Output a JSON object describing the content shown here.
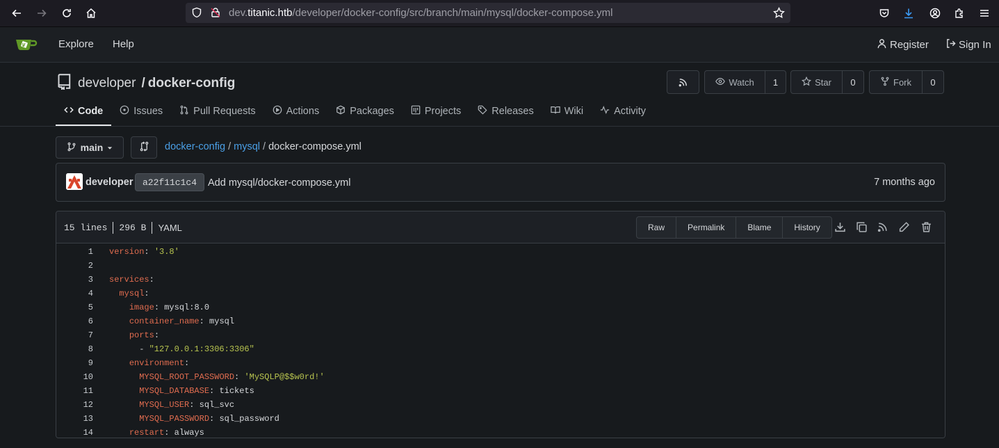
{
  "browser": {
    "url_prefix": "dev.",
    "url_host": "titanic.htb",
    "url_path": "/developer/docker-config/src/branch/main/mysql/docker-compose.yml"
  },
  "header": {
    "explore": "Explore",
    "help": "Help",
    "register": "Register",
    "sign_in": "Sign In"
  },
  "repo": {
    "owner": "developer",
    "separator": "/",
    "name": "docker-config",
    "watch_label": "Watch",
    "watch_count": "1",
    "star_label": "Star",
    "star_count": "0",
    "fork_label": "Fork",
    "fork_count": "0"
  },
  "tabs": [
    {
      "label": "Code",
      "icon": "code-icon"
    },
    {
      "label": "Issues",
      "icon": "issue-icon"
    },
    {
      "label": "Pull Requests",
      "icon": "pull-request-icon"
    },
    {
      "label": "Actions",
      "icon": "play-icon"
    },
    {
      "label": "Packages",
      "icon": "package-icon"
    },
    {
      "label": "Projects",
      "icon": "project-icon"
    },
    {
      "label": "Releases",
      "icon": "tag-icon"
    },
    {
      "label": "Wiki",
      "icon": "book-icon"
    },
    {
      "label": "Activity",
      "icon": "pulse-icon"
    }
  ],
  "branch": {
    "name": "main"
  },
  "breadcrumb": {
    "root": "docker-config",
    "sep1": " / ",
    "dir": "mysql",
    "sep2": " / ",
    "file": "docker-compose.yml"
  },
  "commit": {
    "author": "developer",
    "sha": "a22f11c1c4",
    "message": "Add mysql/docker-compose.yml",
    "time": "7 months ago"
  },
  "file": {
    "lines": "15 lines",
    "size": "296 B",
    "type": "YAML",
    "raw": "Raw",
    "permalink": "Permalink",
    "blame": "Blame",
    "history": "History"
  },
  "code_lines": [
    {
      "n": "1",
      "indent": "",
      "key": "version",
      "colon": ": ",
      "val": "'3.8'",
      "val_type": "s"
    },
    {
      "n": "2",
      "indent": "",
      "key": "",
      "colon": "",
      "val": "",
      "val_type": "p"
    },
    {
      "n": "3",
      "indent": "",
      "key": "services",
      "colon": ":",
      "val": "",
      "val_type": "p"
    },
    {
      "n": "4",
      "indent": "  ",
      "key": "mysql",
      "colon": ":",
      "val": "",
      "val_type": "p"
    },
    {
      "n": "5",
      "indent": "    ",
      "key": "image",
      "colon": ": ",
      "val": "mysql:8.0",
      "val_type": "p"
    },
    {
      "n": "6",
      "indent": "    ",
      "key": "container_name",
      "colon": ": ",
      "val": "mysql",
      "val_type": "p"
    },
    {
      "n": "7",
      "indent": "    ",
      "key": "ports",
      "colon": ":",
      "val": "",
      "val_type": "p"
    },
    {
      "n": "8",
      "indent": "      - ",
      "key": "",
      "colon": "",
      "val": "\"127.0.0.1:3306:3306\"",
      "val_type": "s"
    },
    {
      "n": "9",
      "indent": "    ",
      "key": "environment",
      "colon": ":",
      "val": "",
      "val_type": "p"
    },
    {
      "n": "10",
      "indent": "      ",
      "key": "MYSQL_ROOT_PASSWORD",
      "colon": ": ",
      "val": "'MySQLP@$$w0rd!'",
      "val_type": "s"
    },
    {
      "n": "11",
      "indent": "      ",
      "key": "MYSQL_DATABASE",
      "colon": ": ",
      "val": "tickets",
      "val_type": "p"
    },
    {
      "n": "12",
      "indent": "      ",
      "key": "MYSQL_USER",
      "colon": ": ",
      "val": "sql_svc",
      "val_type": "p"
    },
    {
      "n": "13",
      "indent": "      ",
      "key": "MYSQL_PASSWORD",
      "colon": ": ",
      "val": "sql_password",
      "val_type": "p"
    },
    {
      "n": "14",
      "indent": "    ",
      "key": "restart",
      "colon": ": ",
      "val": "always",
      "val_type": "p"
    }
  ],
  "colors": {
    "yaml_key": "#e06c4f",
    "yaml_string": "#b8c44f",
    "link": "#4a9fe6",
    "logo_green": "#609926"
  }
}
